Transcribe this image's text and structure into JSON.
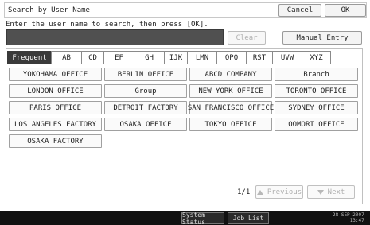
{
  "header": {
    "title": "Search by User Name",
    "cancel_label": "Cancel",
    "ok_label": "OK"
  },
  "instruction": "Enter the user name to search, then press [OK].",
  "input": {
    "value": ""
  },
  "clear_label": "Clear",
  "manual_entry_label": "Manual Entry",
  "tabs": [
    "Frequent",
    "AB",
    "CD",
    "EF",
    "GH",
    "IJK",
    "LMN",
    "OPQ",
    "RST",
    "UVW",
    "XYZ"
  ],
  "entries": [
    "YOKOHAMA OFFICE",
    "BERLIN OFFICE",
    "ABCD COMPANY",
    "Branch",
    "LONDON OFFICE",
    "Group",
    "NEW YORK OFFICE",
    "TORONTO OFFICE",
    "PARIS OFFICE",
    "DETROIT FACTORY",
    "SAN FRANCISCO OFFICE",
    "SYDNEY OFFICE",
    "LOS ANGELES FACTORY",
    "OSAKA OFFICE",
    "TOKYO OFFICE",
    "OOMORI OFFICE",
    "OSAKA FACTORY"
  ],
  "pager": {
    "page": "1/1",
    "previous_label": "Previous",
    "next_label": "Next"
  },
  "statusbar": {
    "system_status_label": "System Status",
    "job_list_label": "Job List",
    "date": "28 SEP 2007",
    "time": "13:47"
  },
  "colors": {
    "active_tab_bg": "#3a3a3a",
    "input_bg": "#505050",
    "statusbar_bg": "#111111"
  }
}
